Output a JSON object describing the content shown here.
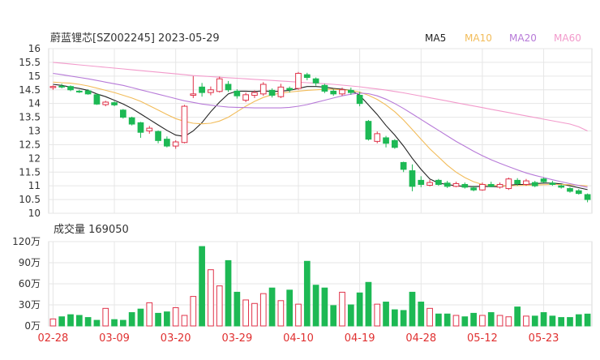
{
  "chart_data": [
    {
      "type": "candlestick",
      "title": "蔚蓝锂芯[SZ002245] 2023-05-29",
      "ylim": [
        10,
        16
      ],
      "yticks": [
        16,
        15.5,
        15,
        14.5,
        14,
        13.5,
        13,
        12.5,
        12,
        11.5,
        11,
        10.5,
        10
      ],
      "x_date_labels": [
        {
          "label": "02-28",
          "index": 0
        },
        {
          "label": "03-09",
          "index": 7
        },
        {
          "label": "03-20",
          "index": 14
        },
        {
          "label": "03-29",
          "index": 21
        },
        {
          "label": "04-10",
          "index": 28
        },
        {
          "label": "04-19",
          "index": 35
        },
        {
          "label": "04-28",
          "index": 42
        },
        {
          "label": "05-12",
          "index": 49
        },
        {
          "label": "05-23",
          "index": 56
        }
      ],
      "colors": {
        "up": "#e0334a",
        "down": "#1db954",
        "MA5": "#222222",
        "MA10": "#f2bc5a",
        "MA20": "#b77ad8",
        "MA60": "#f29acb"
      },
      "candles": [
        [
          14.58,
          14.62,
          14.66,
          14.5
        ],
        [
          14.63,
          14.6,
          14.72,
          14.55
        ],
        [
          14.62,
          14.5,
          14.66,
          14.45
        ],
        [
          14.45,
          14.42,
          14.5,
          14.38
        ],
        [
          14.46,
          14.35,
          14.52,
          14.32
        ],
        [
          14.32,
          13.98,
          14.36,
          13.95
        ],
        [
          13.96,
          14.05,
          14.1,
          13.9
        ],
        [
          14.03,
          13.95,
          14.08,
          13.9
        ],
        [
          13.76,
          13.5,
          13.8,
          13.45
        ],
        [
          13.48,
          13.25,
          13.52,
          13.2
        ],
        [
          13.3,
          12.95,
          13.33,
          12.75
        ],
        [
          13.0,
          13.1,
          13.18,
          12.9
        ],
        [
          12.98,
          12.65,
          13.02,
          12.55
        ],
        [
          12.7,
          12.45,
          12.8,
          12.4
        ],
        [
          12.45,
          12.6,
          12.66,
          12.35
        ],
        [
          12.58,
          13.9,
          13.95,
          12.55
        ],
        [
          14.3,
          14.35,
          15.0,
          14.2
        ],
        [
          14.6,
          14.4,
          14.75,
          14.25
        ],
        [
          14.4,
          14.5,
          14.62,
          14.3
        ],
        [
          14.44,
          14.9,
          14.98,
          14.4
        ],
        [
          14.7,
          14.5,
          14.82,
          14.42
        ],
        [
          14.45,
          14.28,
          14.52,
          14.18
        ],
        [
          14.12,
          14.32,
          14.4,
          14.05
        ],
        [
          14.3,
          14.4,
          14.48,
          14.2
        ],
        [
          14.35,
          14.7,
          14.78,
          14.28
        ],
        [
          14.48,
          14.3,
          14.55,
          14.22
        ],
        [
          14.25,
          14.6,
          14.72,
          14.2
        ],
        [
          14.55,
          14.5,
          14.62,
          14.4
        ],
        [
          14.55,
          15.1,
          15.15,
          14.5
        ],
        [
          15.05,
          14.95,
          15.12,
          14.85
        ],
        [
          14.9,
          14.75,
          14.95,
          14.65
        ],
        [
          14.66,
          14.45,
          14.72,
          14.38
        ],
        [
          14.45,
          14.35,
          14.52,
          14.28
        ],
        [
          14.35,
          14.5,
          14.58,
          14.28
        ],
        [
          14.48,
          14.4,
          14.58,
          14.32
        ],
        [
          14.3,
          14.0,
          14.42,
          13.9
        ],
        [
          13.35,
          12.7,
          13.4,
          12.65
        ],
        [
          12.62,
          12.9,
          12.98,
          12.55
        ],
        [
          12.75,
          12.55,
          12.82,
          12.4
        ],
        [
          12.65,
          12.4,
          12.7,
          12.35
        ],
        [
          11.85,
          11.6,
          11.88,
          11.5
        ],
        [
          11.55,
          10.98,
          11.78,
          10.8
        ],
        [
          11.2,
          11.05,
          11.35,
          10.95
        ],
        [
          11.02,
          11.12,
          11.22,
          10.98
        ],
        [
          11.2,
          11.05,
          11.25,
          11.0
        ],
        [
          11.1,
          10.98,
          11.18,
          10.92
        ],
        [
          10.98,
          11.08,
          11.15,
          10.95
        ],
        [
          11.05,
          10.95,
          11.12,
          10.9
        ],
        [
          10.92,
          10.85,
          11.0,
          10.8
        ],
        [
          10.85,
          11.05,
          11.12,
          10.82
        ],
        [
          11.05,
          10.98,
          11.15,
          10.95
        ],
        [
          10.95,
          11.05,
          11.12,
          10.9
        ],
        [
          10.9,
          11.25,
          11.3,
          10.85
        ],
        [
          11.2,
          11.08,
          11.28,
          11.0
        ],
        [
          11.05,
          11.18,
          11.25,
          11.0
        ],
        [
          11.12,
          11.0,
          11.18,
          10.95
        ],
        [
          11.25,
          11.15,
          11.3,
          11.1
        ],
        [
          11.1,
          11.05,
          11.18,
          11.0
        ],
        [
          11.0,
          10.95,
          11.05,
          10.9
        ],
        [
          10.9,
          10.8,
          10.95,
          10.75
        ],
        [
          10.82,
          10.72,
          10.88,
          10.68
        ],
        [
          10.68,
          10.5,
          10.72,
          10.4
        ]
      ],
      "series": [
        {
          "name": "MA5",
          "values": [
            14.7,
            14.66,
            14.6,
            14.55,
            14.48,
            14.35,
            14.25,
            14.12,
            13.98,
            13.82,
            13.62,
            13.42,
            13.22,
            13.02,
            12.85,
            12.8,
            13.0,
            13.3,
            13.7,
            14.05,
            14.35,
            14.45,
            14.45,
            14.44,
            14.46,
            14.44,
            14.45,
            14.48,
            14.55,
            14.62,
            14.62,
            14.6,
            14.55,
            14.52,
            14.48,
            14.3,
            13.95,
            13.6,
            13.2,
            12.85,
            12.45,
            12.0,
            11.6,
            11.25,
            11.1,
            11.05,
            11.0,
            10.98,
            10.97,
            10.98,
            10.97,
            10.97,
            11.02,
            11.05,
            11.05,
            11.08,
            11.1,
            11.1,
            11.07,
            11.0,
            10.93,
            10.86
          ]
        },
        {
          "name": "MA10",
          "values": [
            14.78,
            14.76,
            14.74,
            14.7,
            14.64,
            14.56,
            14.48,
            14.4,
            14.3,
            14.2,
            14.08,
            13.92,
            13.76,
            13.6,
            13.45,
            13.35,
            13.28,
            13.26,
            13.28,
            13.36,
            13.5,
            13.7,
            13.9,
            14.08,
            14.22,
            14.32,
            14.38,
            14.42,
            14.45,
            14.48,
            14.5,
            14.52,
            14.52,
            14.5,
            14.48,
            14.42,
            14.3,
            14.15,
            13.95,
            13.7,
            13.4,
            13.05,
            12.7,
            12.35,
            12.05,
            11.75,
            11.5,
            11.3,
            11.15,
            11.05,
            11.02,
            11.0,
            11.0,
            11.01,
            11.02,
            11.03,
            11.04,
            11.05,
            11.05,
            11.04,
            11.02,
            11.0
          ]
        },
        {
          "name": "MA20",
          "values": [
            15.1,
            15.05,
            15.0,
            14.95,
            14.9,
            14.84,
            14.78,
            14.72,
            14.66,
            14.58,
            14.5,
            14.42,
            14.34,
            14.26,
            14.18,
            14.1,
            14.04,
            13.98,
            13.94,
            13.9,
            13.87,
            13.86,
            13.85,
            13.84,
            13.84,
            13.84,
            13.84,
            13.86,
            13.9,
            13.96,
            14.04,
            14.12,
            14.2,
            14.28,
            14.34,
            14.38,
            14.36,
            14.28,
            14.16,
            14.0,
            13.82,
            13.62,
            13.42,
            13.22,
            13.02,
            12.82,
            12.62,
            12.44,
            12.26,
            12.1,
            11.95,
            11.82,
            11.7,
            11.58,
            11.47,
            11.38,
            11.3,
            11.22,
            11.15,
            11.08,
            11.01,
            10.95
          ]
        },
        {
          "name": "MA60",
          "values": [
            15.5,
            15.47,
            15.44,
            15.41,
            15.38,
            15.35,
            15.32,
            15.29,
            15.26,
            15.23,
            15.2,
            15.17,
            15.14,
            15.11,
            15.08,
            15.05,
            15.02,
            15.0,
            14.98,
            14.96,
            14.94,
            14.92,
            14.9,
            14.88,
            14.86,
            14.84,
            14.82,
            14.8,
            14.78,
            14.76,
            14.74,
            14.72,
            14.7,
            14.67,
            14.64,
            14.61,
            14.57,
            14.53,
            14.49,
            14.44,
            14.39,
            14.33,
            14.27,
            14.21,
            14.15,
            14.09,
            14.03,
            13.97,
            13.91,
            13.85,
            13.79,
            13.73,
            13.67,
            13.61,
            13.55,
            13.49,
            13.43,
            13.37,
            13.31,
            13.25,
            13.15,
            13.0
          ]
        }
      ],
      "legend_position": "top-right"
    },
    {
      "type": "bar",
      "title": "成交量 169050",
      "ylim": [
        0,
        1200000
      ],
      "yticks": [
        {
          "label": "120万",
          "value": 1200000
        },
        {
          "label": "90万",
          "value": 900000
        },
        {
          "label": "60万",
          "value": 600000
        },
        {
          "label": "30万",
          "value": 300000
        },
        {
          "label": "0万",
          "value": 0
        }
      ],
      "values": [
        100000,
        130000,
        160000,
        150000,
        120000,
        80000,
        250000,
        90000,
        80000,
        190000,
        240000,
        330000,
        180000,
        200000,
        260000,
        150000,
        420000,
        1130000,
        800000,
        570000,
        930000,
        480000,
        370000,
        320000,
        460000,
        540000,
        360000,
        510000,
        310000,
        920000,
        580000,
        540000,
        290000,
        480000,
        300000,
        470000,
        620000,
        310000,
        340000,
        230000,
        220000,
        480000,
        340000,
        250000,
        170000,
        170000,
        150000,
        130000,
        180000,
        150000,
        190000,
        150000,
        130000,
        270000,
        140000,
        140000,
        190000,
        140000,
        120000,
        120000,
        160000,
        169050
      ]
    }
  ]
}
